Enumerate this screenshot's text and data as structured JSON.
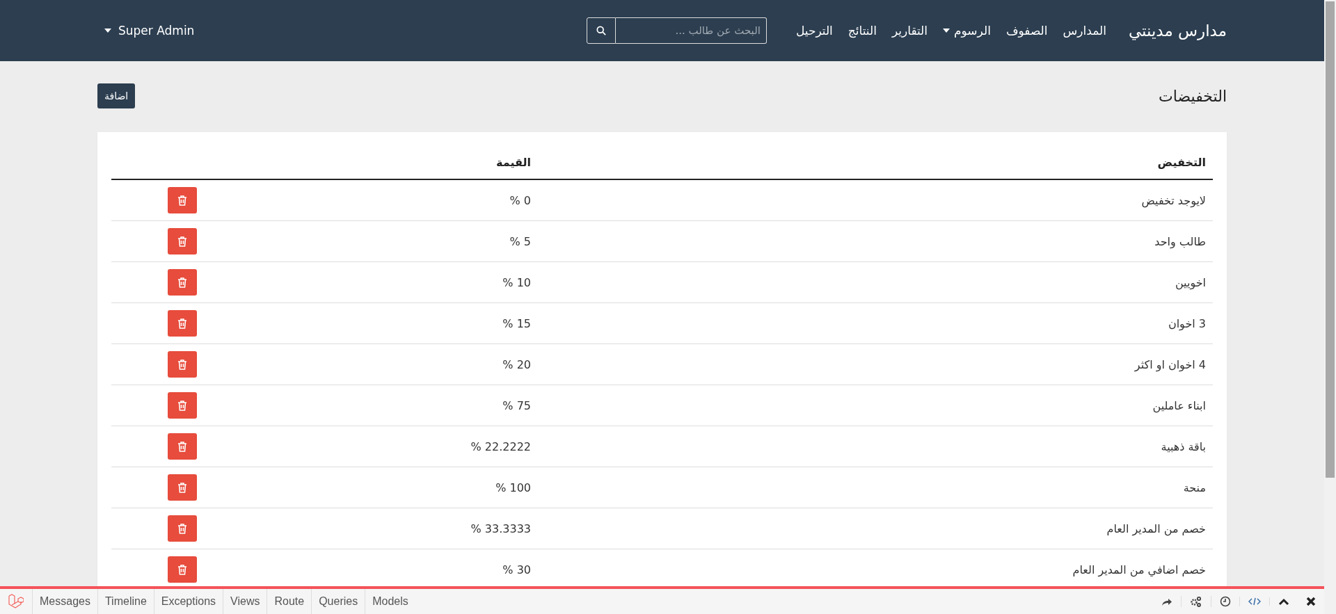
{
  "navbar": {
    "brand": "مدارس مدينتي",
    "links": [
      {
        "label": "المدارس",
        "dropdown": false
      },
      {
        "label": "الصفوف",
        "dropdown": false
      },
      {
        "label": "الرسوم",
        "dropdown": true
      },
      {
        "label": "التقارير",
        "dropdown": false
      },
      {
        "label": "النتائج",
        "dropdown": false
      },
      {
        "label": "الترحيل",
        "dropdown": false
      }
    ],
    "search": {
      "placeholder": "البحث عن طالب ..."
    },
    "user": "Super Admin"
  },
  "page": {
    "title": "التخفيضات",
    "add_button": "اضافة"
  },
  "table": {
    "columns": [
      "التخفيض",
      "القيمة"
    ],
    "rows": [
      {
        "name": "لايوجد تخفيض",
        "value": "0 %"
      },
      {
        "name": "طالب واحد",
        "value": "5 %"
      },
      {
        "name": "اخويين",
        "value": "10 %"
      },
      {
        "name": "3 اخوان",
        "value": "15 %"
      },
      {
        "name": "4 اخوان او اكثر",
        "value": "20 %"
      },
      {
        "name": "ابناء عاملين",
        "value": "75 %"
      },
      {
        "name": "باقة ذهبية",
        "value": "22.2222 %"
      },
      {
        "name": "منحة",
        "value": "100 %"
      },
      {
        "name": "خصم من المدير العام",
        "value": "33.3333 %"
      },
      {
        "name": "خصم اضافي من المدير العام",
        "value": "30 %"
      }
    ]
  },
  "debugbar": {
    "messages_tab": "Messages",
    "timeline_tab": "Timeline",
    "exceptions_tab": "Exceptions",
    "views_tab": "Views",
    "route_tab": "Route",
    "queries_tab": "Queries",
    "models_tab": "Models"
  }
}
